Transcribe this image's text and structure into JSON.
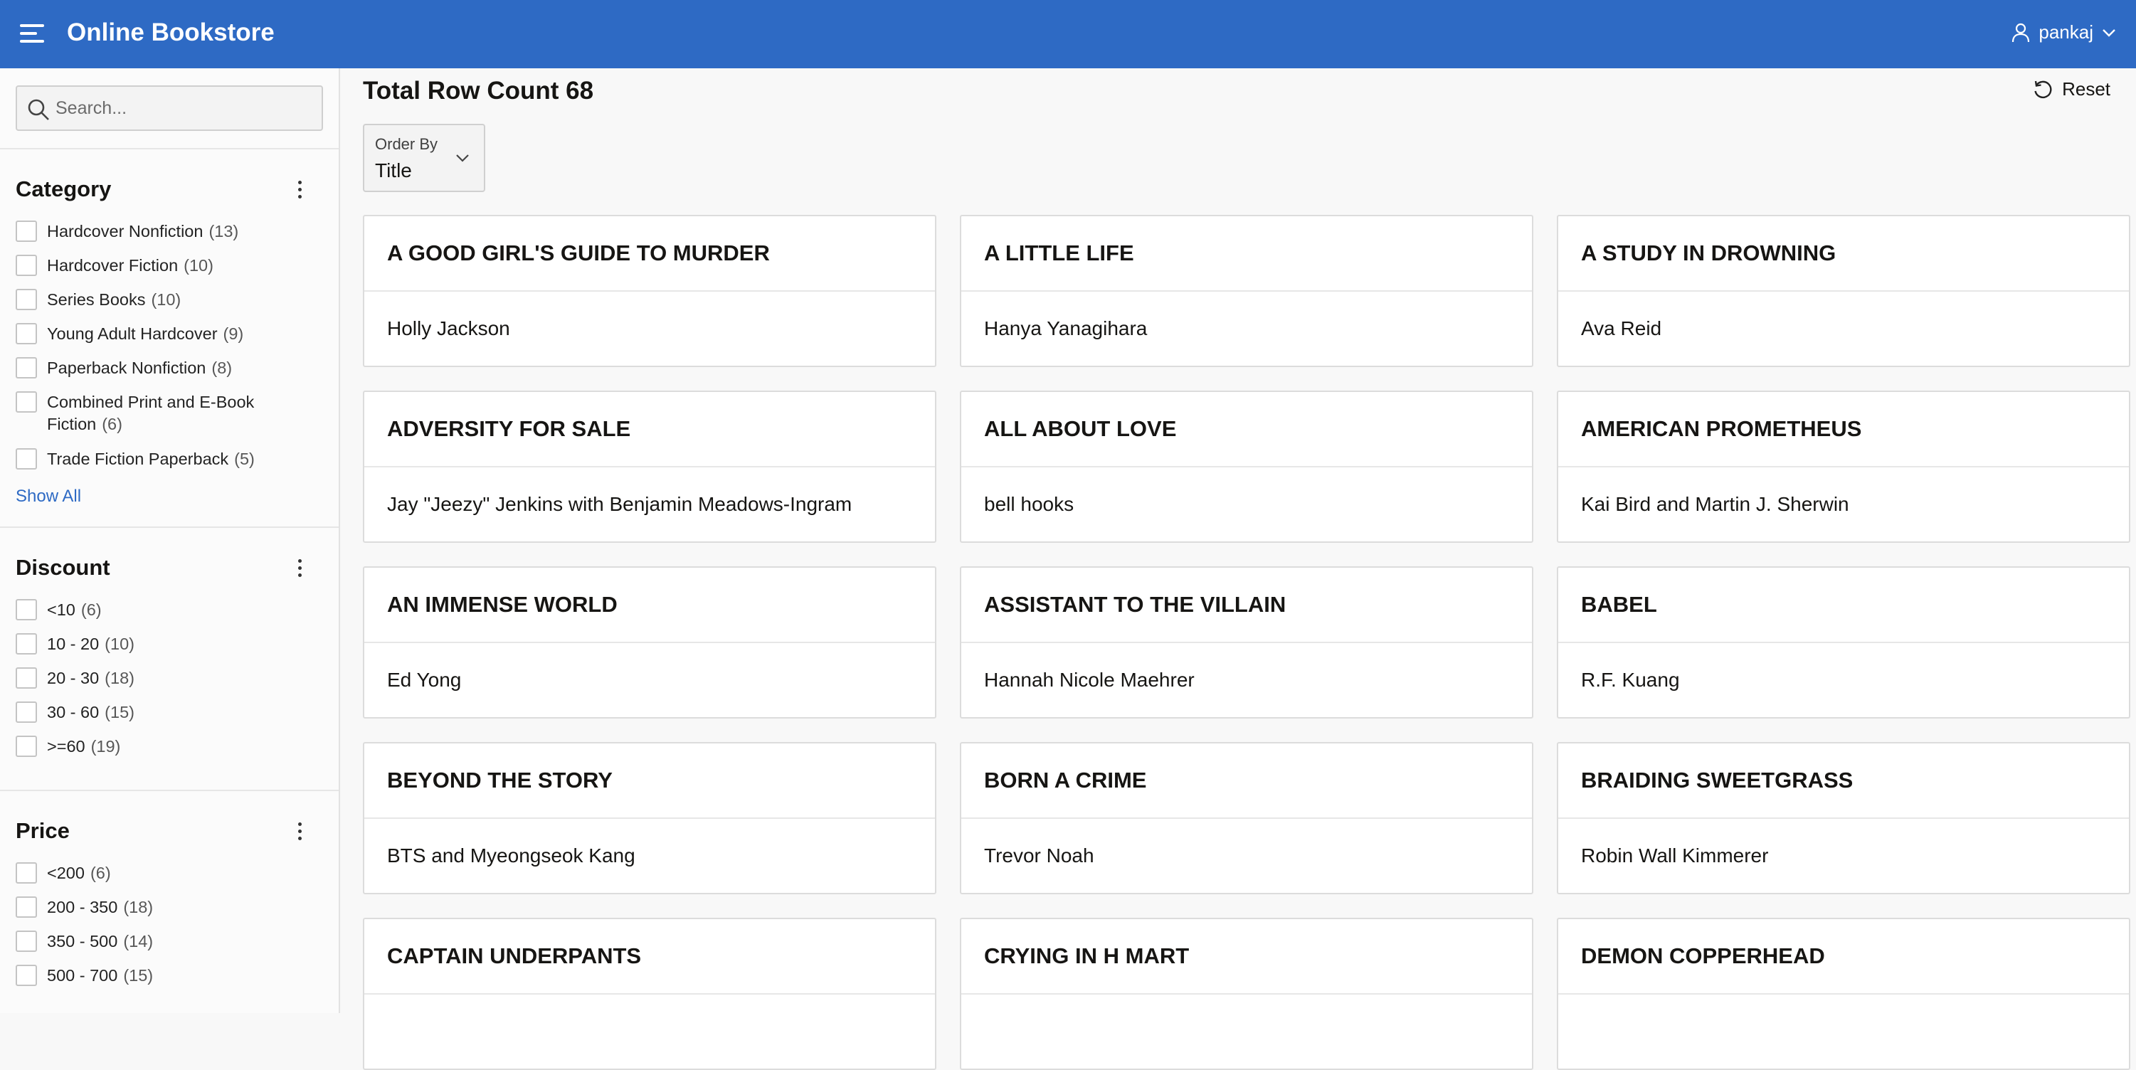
{
  "header": {
    "app_title": "Online Bookstore",
    "user_name": "pankaj",
    "accent_color": "#2e6ac4"
  },
  "sidebar": {
    "search_placeholder": "Search...",
    "facets": [
      {
        "title": "Category",
        "items": [
          {
            "label": "Hardcover Nonfiction",
            "count": "(13)"
          },
          {
            "label": "Hardcover Fiction",
            "count": "(10)"
          },
          {
            "label": "Series Books",
            "count": "(10)"
          },
          {
            "label": "Young Adult Hardcover",
            "count": "(9)"
          },
          {
            "label": "Paperback Nonfiction",
            "count": "(8)"
          },
          {
            "label": "Combined Print and E-Book Fiction",
            "count": "(6)"
          },
          {
            "label": "Trade Fiction Paperback",
            "count": "(5)"
          }
        ],
        "show_all": "Show All"
      },
      {
        "title": "Discount",
        "items": [
          {
            "label": "<10",
            "count": "(6)"
          },
          {
            "label": "10 - 20",
            "count": "(10)"
          },
          {
            "label": "20 - 30",
            "count": "(18)"
          },
          {
            "label": "30 - 60",
            "count": "(15)"
          },
          {
            "label": ">=60",
            "count": "(19)"
          }
        ]
      },
      {
        "title": "Price",
        "items": [
          {
            "label": "<200",
            "count": "(6)"
          },
          {
            "label": "200 - 350",
            "count": "(18)"
          },
          {
            "label": "350 - 500",
            "count": "(14)"
          },
          {
            "label": "500 - 700",
            "count": "(15)"
          }
        ]
      }
    ]
  },
  "main": {
    "row_count_text": "Total Row Count 68",
    "reset_label": "Reset",
    "order_by": {
      "label": "Order By",
      "value": "Title"
    },
    "books": [
      {
        "title": "A GOOD GIRL'S GUIDE TO MURDER",
        "author": "Holly Jackson"
      },
      {
        "title": "A LITTLE LIFE",
        "author": "Hanya Yanagihara"
      },
      {
        "title": "A STUDY IN DROWNING",
        "author": "Ava Reid"
      },
      {
        "title": "ADVERSITY FOR SALE",
        "author": "Jay \"Jeezy\" Jenkins with Benjamin Meadows-Ingram"
      },
      {
        "title": "ALL ABOUT LOVE",
        "author": "bell hooks"
      },
      {
        "title": "AMERICAN PROMETHEUS",
        "author": "Kai Bird and Martin J. Sherwin"
      },
      {
        "title": "AN IMMENSE WORLD",
        "author": "Ed Yong"
      },
      {
        "title": "ASSISTANT TO THE VILLAIN",
        "author": "Hannah Nicole Maehrer"
      },
      {
        "title": "BABEL",
        "author": "R.F. Kuang"
      },
      {
        "title": "BEYOND THE STORY",
        "author": "BTS and Myeongseok Kang"
      },
      {
        "title": "BORN A CRIME",
        "author": "Trevor Noah"
      },
      {
        "title": "BRAIDING SWEETGRASS",
        "author": "Robin Wall Kimmerer"
      },
      {
        "title": "CAPTAIN UNDERPANTS",
        "author": ""
      },
      {
        "title": "CRYING IN H MART",
        "author": ""
      },
      {
        "title": "DEMON COPPERHEAD",
        "author": ""
      }
    ]
  }
}
